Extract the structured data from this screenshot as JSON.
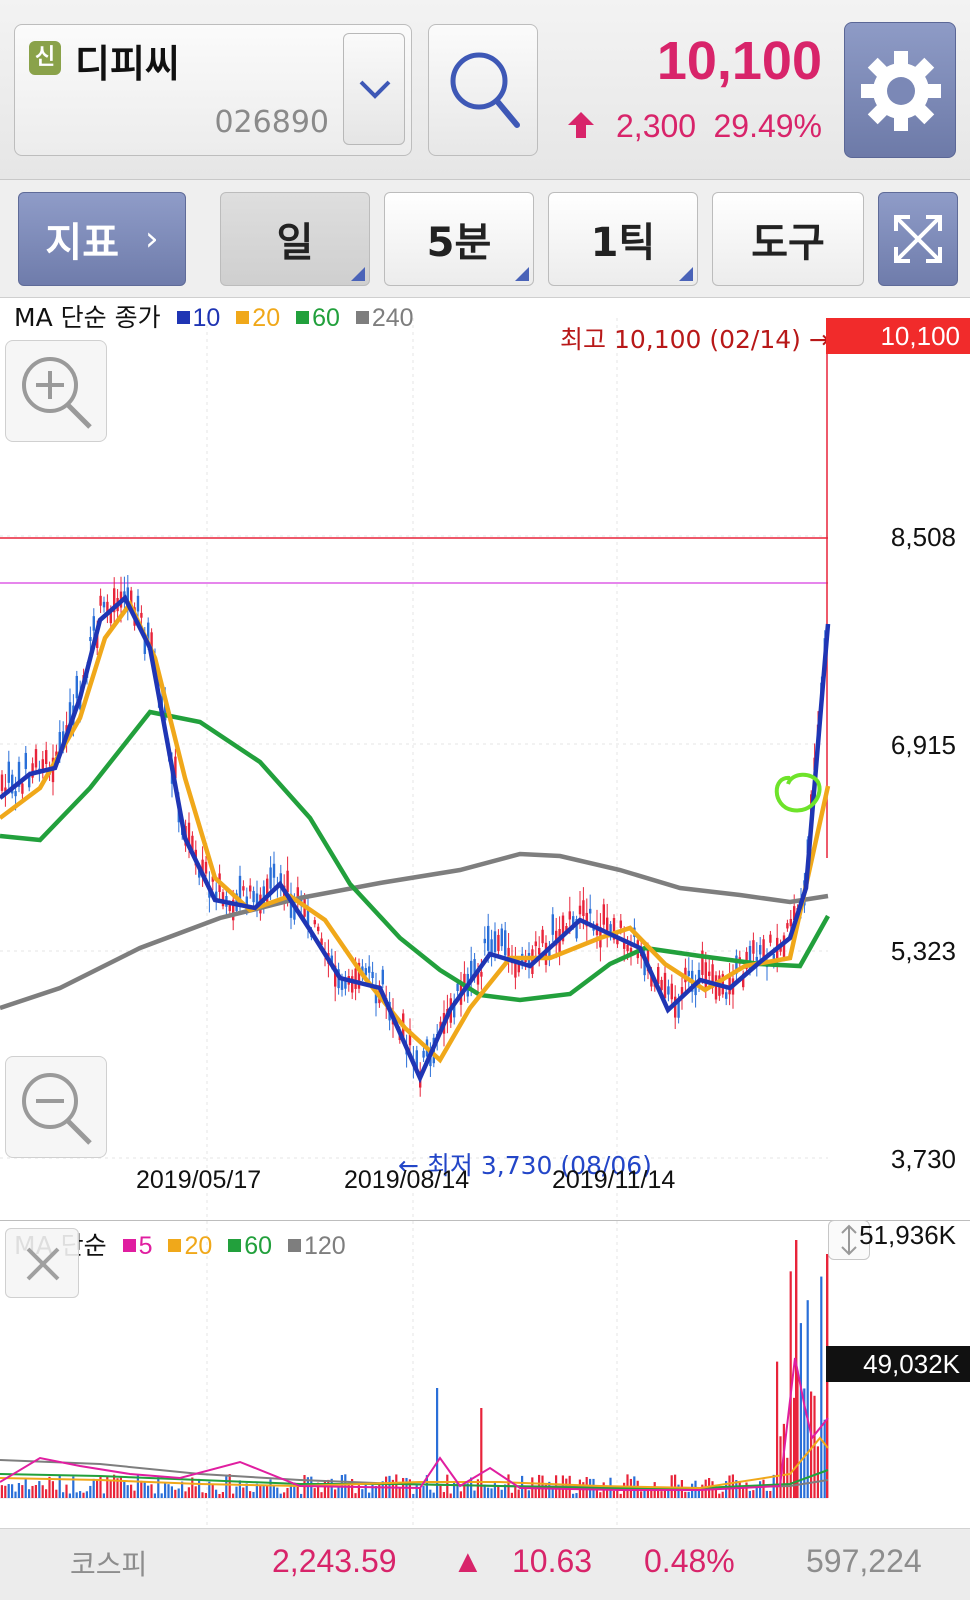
{
  "header": {
    "new_badge": "신",
    "stock_name": "디피씨",
    "stock_code": "026890",
    "price": "10,100",
    "change_abs": "2,300",
    "change_pct": "29.49%"
  },
  "toolbar": {
    "indicator_label": "지표",
    "day_label": "일",
    "minute_label": "5분",
    "tick_label": "1틱",
    "tools_label": "도구"
  },
  "price_chart": {
    "legend_title": "MA 단순 종가",
    "legend": [
      {
        "label": "10",
        "color": "#1f35b4"
      },
      {
        "label": "20",
        "color": "#f0a81a"
      },
      {
        "label": "60",
        "color": "#22a03c"
      },
      {
        "label": "240",
        "color": "#7e7e7e"
      }
    ],
    "high_text": "최고 10,100 (02/14) →",
    "low_text": "← 최저 3,730 (08/06)",
    "y_labels": [
      "10,100",
      "8,508",
      "6,915",
      "5,323",
      "3,730"
    ],
    "x_labels": [
      "2019/05/17",
      "2019/08/14",
      "2019/11/14"
    ]
  },
  "volume_chart": {
    "legend_title": "MA 단순",
    "legend": [
      {
        "label": "5",
        "color": "#e01ea0"
      },
      {
        "label": "20",
        "color": "#f0a81a"
      },
      {
        "label": "60",
        "color": "#22a03c"
      },
      {
        "label": "120",
        "color": "#7e7e7e"
      }
    ],
    "y_max": "51,936K",
    "last_volume": "49,032K"
  },
  "bottom_bar": {
    "index_name": "코스피",
    "index_value": "2,243.59",
    "index_arrow": "▲",
    "index_change": "10.63",
    "index_pct": "0.48%",
    "index_volume": "597,224"
  },
  "colors": {
    "up": "#d8246a",
    "accent_button": "#7b88b6",
    "high_line": "#e8243a",
    "low_label": "#2346c8"
  }
}
